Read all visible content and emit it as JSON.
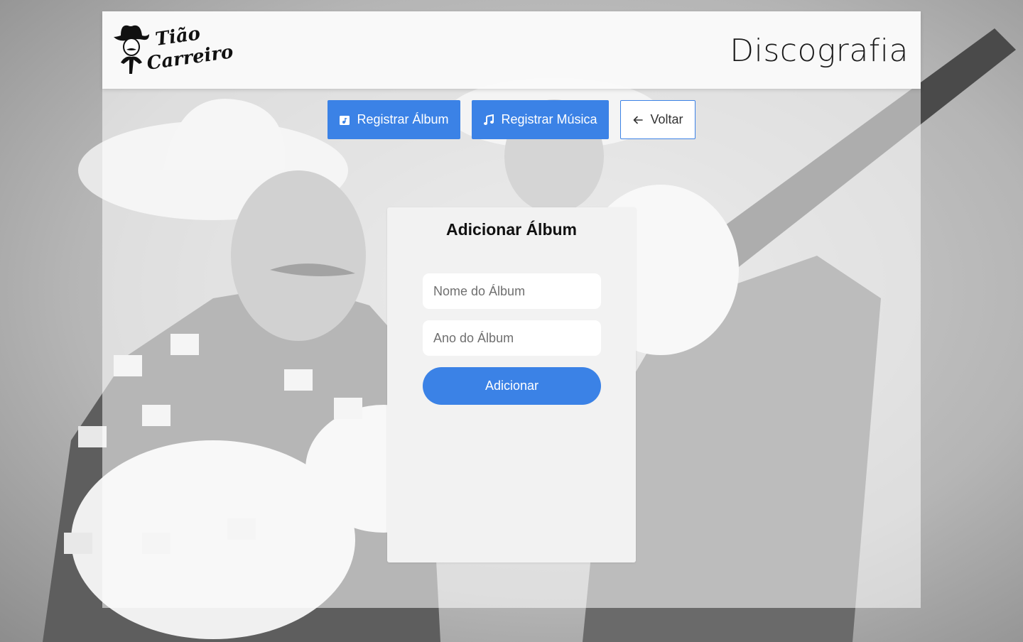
{
  "header": {
    "logo_text_line1": "Tião",
    "logo_text_line2": "Carreiro",
    "title": "Discografia"
  },
  "toolbar": {
    "register_album_label": "Registrar Álbum",
    "register_album_icon": "album-plus-icon",
    "register_song_label": "Registrar Música",
    "register_song_icon": "music-note-icon",
    "back_label": "Voltar",
    "back_icon": "arrow-left-icon"
  },
  "form": {
    "title": "Adicionar Álbum",
    "album_name_placeholder": "Nome do Álbum",
    "album_year_placeholder": "Ano do Álbum",
    "submit_label": "Adicionar"
  },
  "colors": {
    "primary": "#3b82e6",
    "card_bg": "#f2f2f2",
    "header_bg": "#fafafa"
  }
}
